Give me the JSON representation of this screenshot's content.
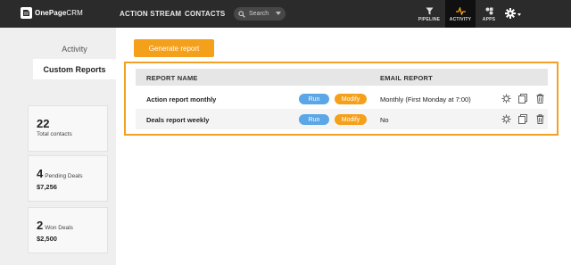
{
  "topbar": {
    "logo_bold": "OnePage",
    "logo_light": "CRM",
    "nav": [
      "ACTION STREAM",
      "CONTACTS"
    ],
    "search_placeholder": "Search",
    "tabs": [
      {
        "label": "PIPELINE",
        "icon": "filter-icon",
        "active": false
      },
      {
        "label": "ACTIVITY",
        "icon": "pulse-icon",
        "active": true
      },
      {
        "label": "APPS",
        "icon": "apps-icon",
        "active": false
      }
    ],
    "settings_icon": "gear-icon"
  },
  "sidebar": {
    "tabs": [
      {
        "label": "Activity",
        "active": false
      },
      {
        "label": "Custom Reports",
        "active": true
      }
    ],
    "stats": [
      {
        "value": "22",
        "label": "Total contacts",
        "sub": ""
      },
      {
        "value": "4",
        "label": "Pending Deals",
        "sub": "$7,256"
      },
      {
        "value": "2",
        "label": "Won Deals",
        "sub": "$2,500"
      }
    ]
  },
  "main": {
    "generate_label": "Generate report",
    "headers": {
      "name": "REPORT NAME",
      "email": "EMAIL REPORT"
    },
    "rows": [
      {
        "name": "Action report monthly",
        "run": "Run",
        "modify": "Modify",
        "email": "Monthly (First Monday at 7:00)"
      },
      {
        "name": "Deals report weekly",
        "run": "Run",
        "modify": "Modify",
        "email": "No"
      }
    ],
    "row_icons": [
      "gear-icon",
      "copy-icon",
      "trash-icon"
    ]
  },
  "colors": {
    "accent": "#f5a01a",
    "run": "#5aa6e6",
    "topbar": "#2b2b2b",
    "highlight": "#f3a023"
  }
}
